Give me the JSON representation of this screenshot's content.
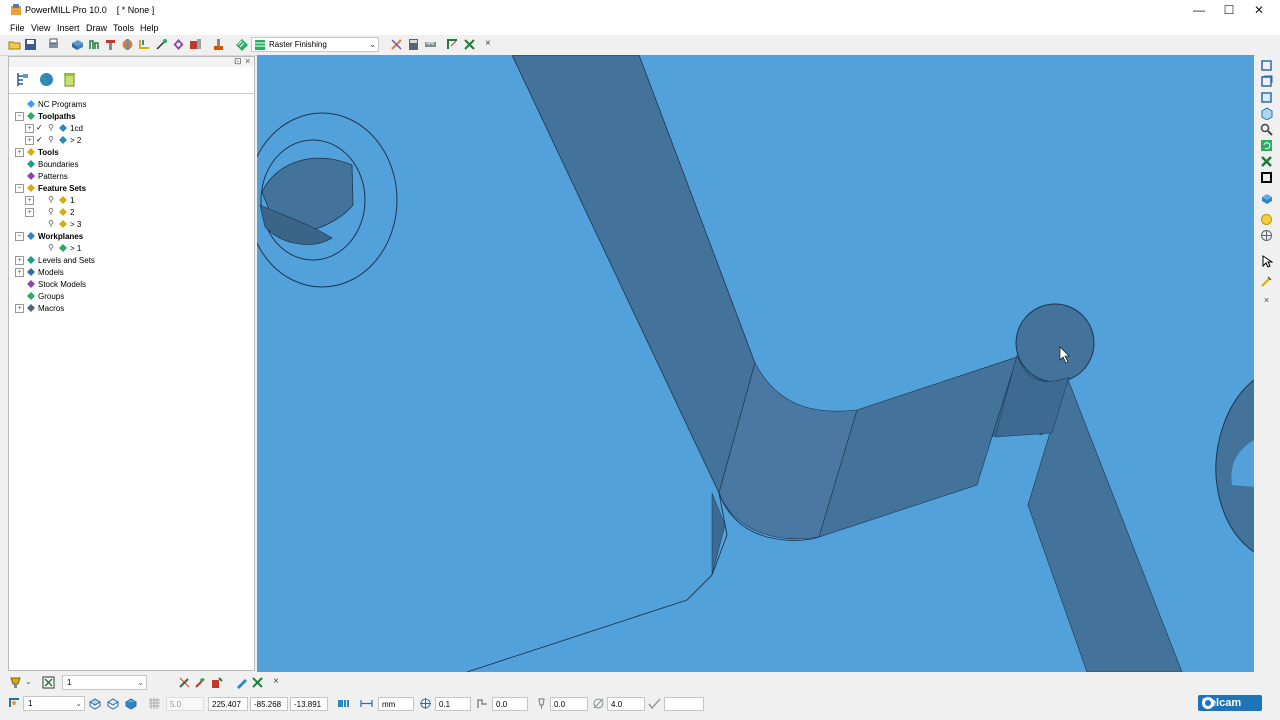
{
  "window": {
    "title": "PowerMILL Pro 10.0    [ * None ]",
    "controls": {
      "minimize": "—",
      "maximize": "☐",
      "close": "✕"
    }
  },
  "menu": [
    "File",
    "View",
    "Insert",
    "Draw",
    "Tools",
    "Help"
  ],
  "toolbar": {
    "strategy_selected": "Raster Finishing",
    "close_glyph": "×"
  },
  "explorer": {
    "header_glyphs": {
      "pin": "⊡",
      "close": "×"
    },
    "tree": [
      {
        "label": "NC Programs",
        "bold": false,
        "expander": ""
      },
      {
        "label": "Toolpaths",
        "bold": true,
        "expander": "−"
      },
      {
        "label": "1cd",
        "bold": false,
        "expander": "+"
      },
      {
        "label": "> 2",
        "bold": false,
        "expander": "+"
      },
      {
        "label": "Tools",
        "bold": true,
        "expander": "+"
      },
      {
        "label": "Boundaries",
        "bold": false,
        "expander": ""
      },
      {
        "label": "Patterns",
        "bold": false,
        "expander": ""
      },
      {
        "label": "Feature Sets",
        "bold": true,
        "expander": "−"
      },
      {
        "label": "1",
        "bold": false,
        "expander": "+"
      },
      {
        "label": "2",
        "bold": false,
        "expander": "+"
      },
      {
        "label": "> 3",
        "bold": false,
        "expander": ""
      },
      {
        "label": "Workplanes",
        "bold": true,
        "expander": "−"
      },
      {
        "label": "> 1",
        "bold": false,
        "expander": ""
      },
      {
        "label": "Levels and Sets",
        "bold": false,
        "expander": "+"
      },
      {
        "label": "Models",
        "bold": false,
        "expander": "+"
      },
      {
        "label": "Stock Models",
        "bold": false,
        "expander": ""
      },
      {
        "label": "Groups",
        "bold": false,
        "expander": ""
      },
      {
        "label": "Macros",
        "bold": false,
        "expander": "+"
      }
    ]
  },
  "viewport": {
    "background": "#52a1db",
    "part_color": "#43729b",
    "edge_color": "#1c3550"
  },
  "status_toolbar": {
    "tool_combo": "1",
    "close_glyph": "×",
    "workplane_combo": "1",
    "grid_value": "5.0",
    "coord_x": "225.407",
    "coord_y": "-85.268",
    "coord_z": "-13.891",
    "units": "mm",
    "tolerance": "0.1",
    "thickness": "0.0",
    "axial_thickness": "0.0",
    "diameter": "4.0",
    "spare_field": "",
    "brand": "Delcam"
  }
}
